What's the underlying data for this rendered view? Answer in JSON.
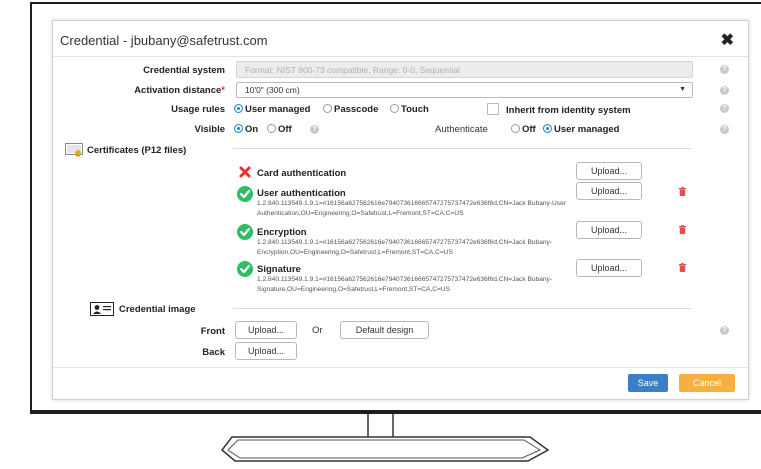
{
  "dialog": {
    "title": "Credential - jbubany@safetrust.com",
    "close_label": "✖"
  },
  "form": {
    "credential_system": {
      "label": "Credential system",
      "value": "Format: NIST 800-73 compatible, Range: 0-0, Sequential"
    },
    "activation_distance": {
      "label": "Activation distance",
      "required_mark": "*",
      "value": "10'0\" (300 cm)"
    },
    "usage_rules": {
      "label": "Usage rules",
      "options": [
        "User managed",
        "Passcode",
        "Touch"
      ],
      "selected": "User managed",
      "inherit_label": "Inherit from identity system"
    },
    "visible": {
      "label": "Visible",
      "options": [
        "On",
        "Off"
      ],
      "selected": "On"
    },
    "authenticate": {
      "label": "Authenticate",
      "options": [
        "Off",
        "User managed"
      ],
      "selected": "User managed"
    }
  },
  "certificates": {
    "label": "Certificates (P12 files)",
    "upload_label": "Upload...",
    "items": [
      {
        "name": "Card authentication",
        "status": "missing",
        "detail": ""
      },
      {
        "name": "User authentication",
        "status": "ok",
        "detail": "1.2.840.113549.1.9.1=#16156a627562616e794073616665747275737472e636f6d,CN=Jack Bubany-User Authentication,OU=Engineering,O=Safetrust,L=Fremont,ST=CA,C=US"
      },
      {
        "name": "Encryption",
        "status": "ok",
        "detail": "1.2.840.113549.1.9.1=#16156a627562616e794073616665747275737472e636f6d,CN=Jack Bubany-Encryption,OU=Engineering,O=Safetrust,L=Fremont,ST=CA,C=US"
      },
      {
        "name": "Signature",
        "status": "ok",
        "detail": "1.2.840.113549.1.9.1=#16156a627562616e794073616665747275737472e636f6d,CN=Jack Bubany-Signature,OU=Engineering,O=Safetrust,L=Fremont,ST=CA,C=US"
      }
    ]
  },
  "credential_image": {
    "label": "Credential image",
    "front_label": "Front",
    "back_label": "Back",
    "upload_label": "Upload...",
    "or_label": "Or",
    "default_design_label": "Default design"
  },
  "footer": {
    "save_label": "Save",
    "cancel_label": "Cancel"
  },
  "colors": {
    "accent": "#1c86d6",
    "save": "#3d7fc4",
    "cancel": "#f5b041",
    "ok": "#2dbd63",
    "missing": "#e8322b",
    "trash": "#e05050"
  },
  "icons": [
    "close-icon",
    "help-icon",
    "certificate-icon",
    "error-x-icon",
    "check-circle-icon",
    "trash-icon",
    "id-card-icon",
    "chevron-down-icon"
  ]
}
